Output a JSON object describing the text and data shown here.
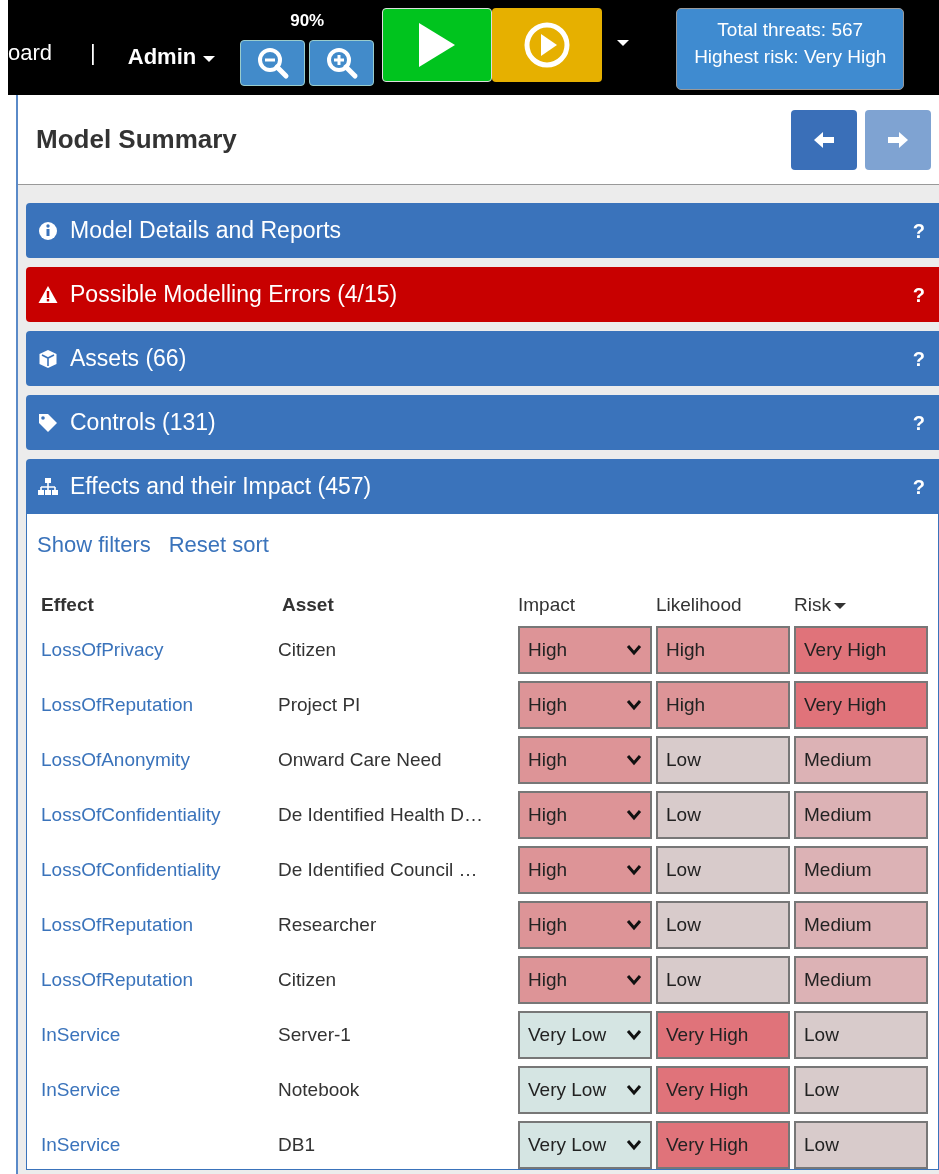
{
  "topbar": {
    "nav_fragment": "oard",
    "separator": "|",
    "admin_menu": "Admin",
    "zoom_level": "90%",
    "threats": [
      "Total threats: 567",
      "Highest risk: Very High"
    ]
  },
  "summary": {
    "title": "Model Summary",
    "back_disabled": false,
    "forward_disabled": true
  },
  "sections": [
    {
      "kind": "info",
      "title": "Model Details and Reports",
      "help": "?",
      "color": "#3a73bb",
      "expanded": false
    },
    {
      "kind": "warning",
      "title": "Possible Modelling Errors (4/15)",
      "help": "?",
      "color": "#c80000",
      "expanded": false
    },
    {
      "kind": "asset",
      "title": "Assets (66)",
      "help": "?",
      "color": "#3a73bb",
      "expanded": false
    },
    {
      "kind": "tag",
      "title": "Controls (131)",
      "help": "?",
      "color": "#3a73bb",
      "expanded": false
    },
    {
      "kind": "tree",
      "title": "Effects and their Impact (457)",
      "help": "?",
      "color": "#3a73bb",
      "expanded": true
    }
  ],
  "effects": {
    "links": [
      "Show filters",
      "Reset sort"
    ],
    "columns": [
      {
        "label": "Effect",
        "sorted": false
      },
      {
        "label": "Asset",
        "sorted": false
      },
      {
        "label": "Impact",
        "sorted": false
      },
      {
        "label": "Likelihood",
        "sorted": false
      },
      {
        "label": "Risk",
        "sorted": true
      }
    ],
    "rows": [
      {
        "effect": "LossOfPrivacy",
        "asset": "Citizen",
        "impact": {
          "value": "High",
          "color": "#dd9497"
        },
        "likelihood": {
          "value": "High",
          "color": "#dd9497"
        },
        "risk": {
          "value": "Very High",
          "color": "#e0737a"
        }
      },
      {
        "effect": "LossOfReputation",
        "asset": "Project PI",
        "impact": {
          "value": "High",
          "color": "#dd9497"
        },
        "likelihood": {
          "value": "High",
          "color": "#dd9497"
        },
        "risk": {
          "value": "Very High",
          "color": "#e0737a"
        }
      },
      {
        "effect": "LossOfAnonymity",
        "asset": "Onward Care Need",
        "impact": {
          "value": "High",
          "color": "#dd9497"
        },
        "likelihood": {
          "value": "Low",
          "color": "#d8cbcb"
        },
        "risk": {
          "value": "Medium",
          "color": "#dcb2b5"
        }
      },
      {
        "effect": "LossOfConfidentiality",
        "asset": "De Identified Health D…",
        "impact": {
          "value": "High",
          "color": "#dd9497"
        },
        "likelihood": {
          "value": "Low",
          "color": "#d8cbcb"
        },
        "risk": {
          "value": "Medium",
          "color": "#dcb2b5"
        }
      },
      {
        "effect": "LossOfConfidentiality",
        "asset": "De Identified Council …",
        "impact": {
          "value": "High",
          "color": "#dd9497"
        },
        "likelihood": {
          "value": "Low",
          "color": "#d8cbcb"
        },
        "risk": {
          "value": "Medium",
          "color": "#dcb2b5"
        }
      },
      {
        "effect": "LossOfReputation",
        "asset": "Researcher",
        "impact": {
          "value": "High",
          "color": "#dd9497"
        },
        "likelihood": {
          "value": "Low",
          "color": "#d8cbcb"
        },
        "risk": {
          "value": "Medium",
          "color": "#dcb2b5"
        }
      },
      {
        "effect": "LossOfReputation",
        "asset": "Citizen",
        "impact": {
          "value": "High",
          "color": "#dd9497"
        },
        "likelihood": {
          "value": "Low",
          "color": "#d8cbcb"
        },
        "risk": {
          "value": "Medium",
          "color": "#dcb2b5"
        }
      },
      {
        "effect": "InService",
        "asset": "Server-1",
        "impact": {
          "value": "Very Low",
          "color": "#d5e5e3"
        },
        "likelihood": {
          "value": "Very High",
          "color": "#e0737a"
        },
        "risk": {
          "value": "Low",
          "color": "#d8cbcb"
        }
      },
      {
        "effect": "InService",
        "asset": "Notebook",
        "impact": {
          "value": "Very Low",
          "color": "#d5e5e3"
        },
        "likelihood": {
          "value": "Very High",
          "color": "#e0737a"
        },
        "risk": {
          "value": "Low",
          "color": "#d8cbcb"
        }
      },
      {
        "effect": "InService",
        "asset": "DB1",
        "impact": {
          "value": "Very Low",
          "color": "#d5e5e3"
        },
        "likelihood": {
          "value": "Very High",
          "color": "#e0737a"
        },
        "risk": {
          "value": "Low",
          "color": "#d8cbcb"
        }
      }
    ]
  }
}
